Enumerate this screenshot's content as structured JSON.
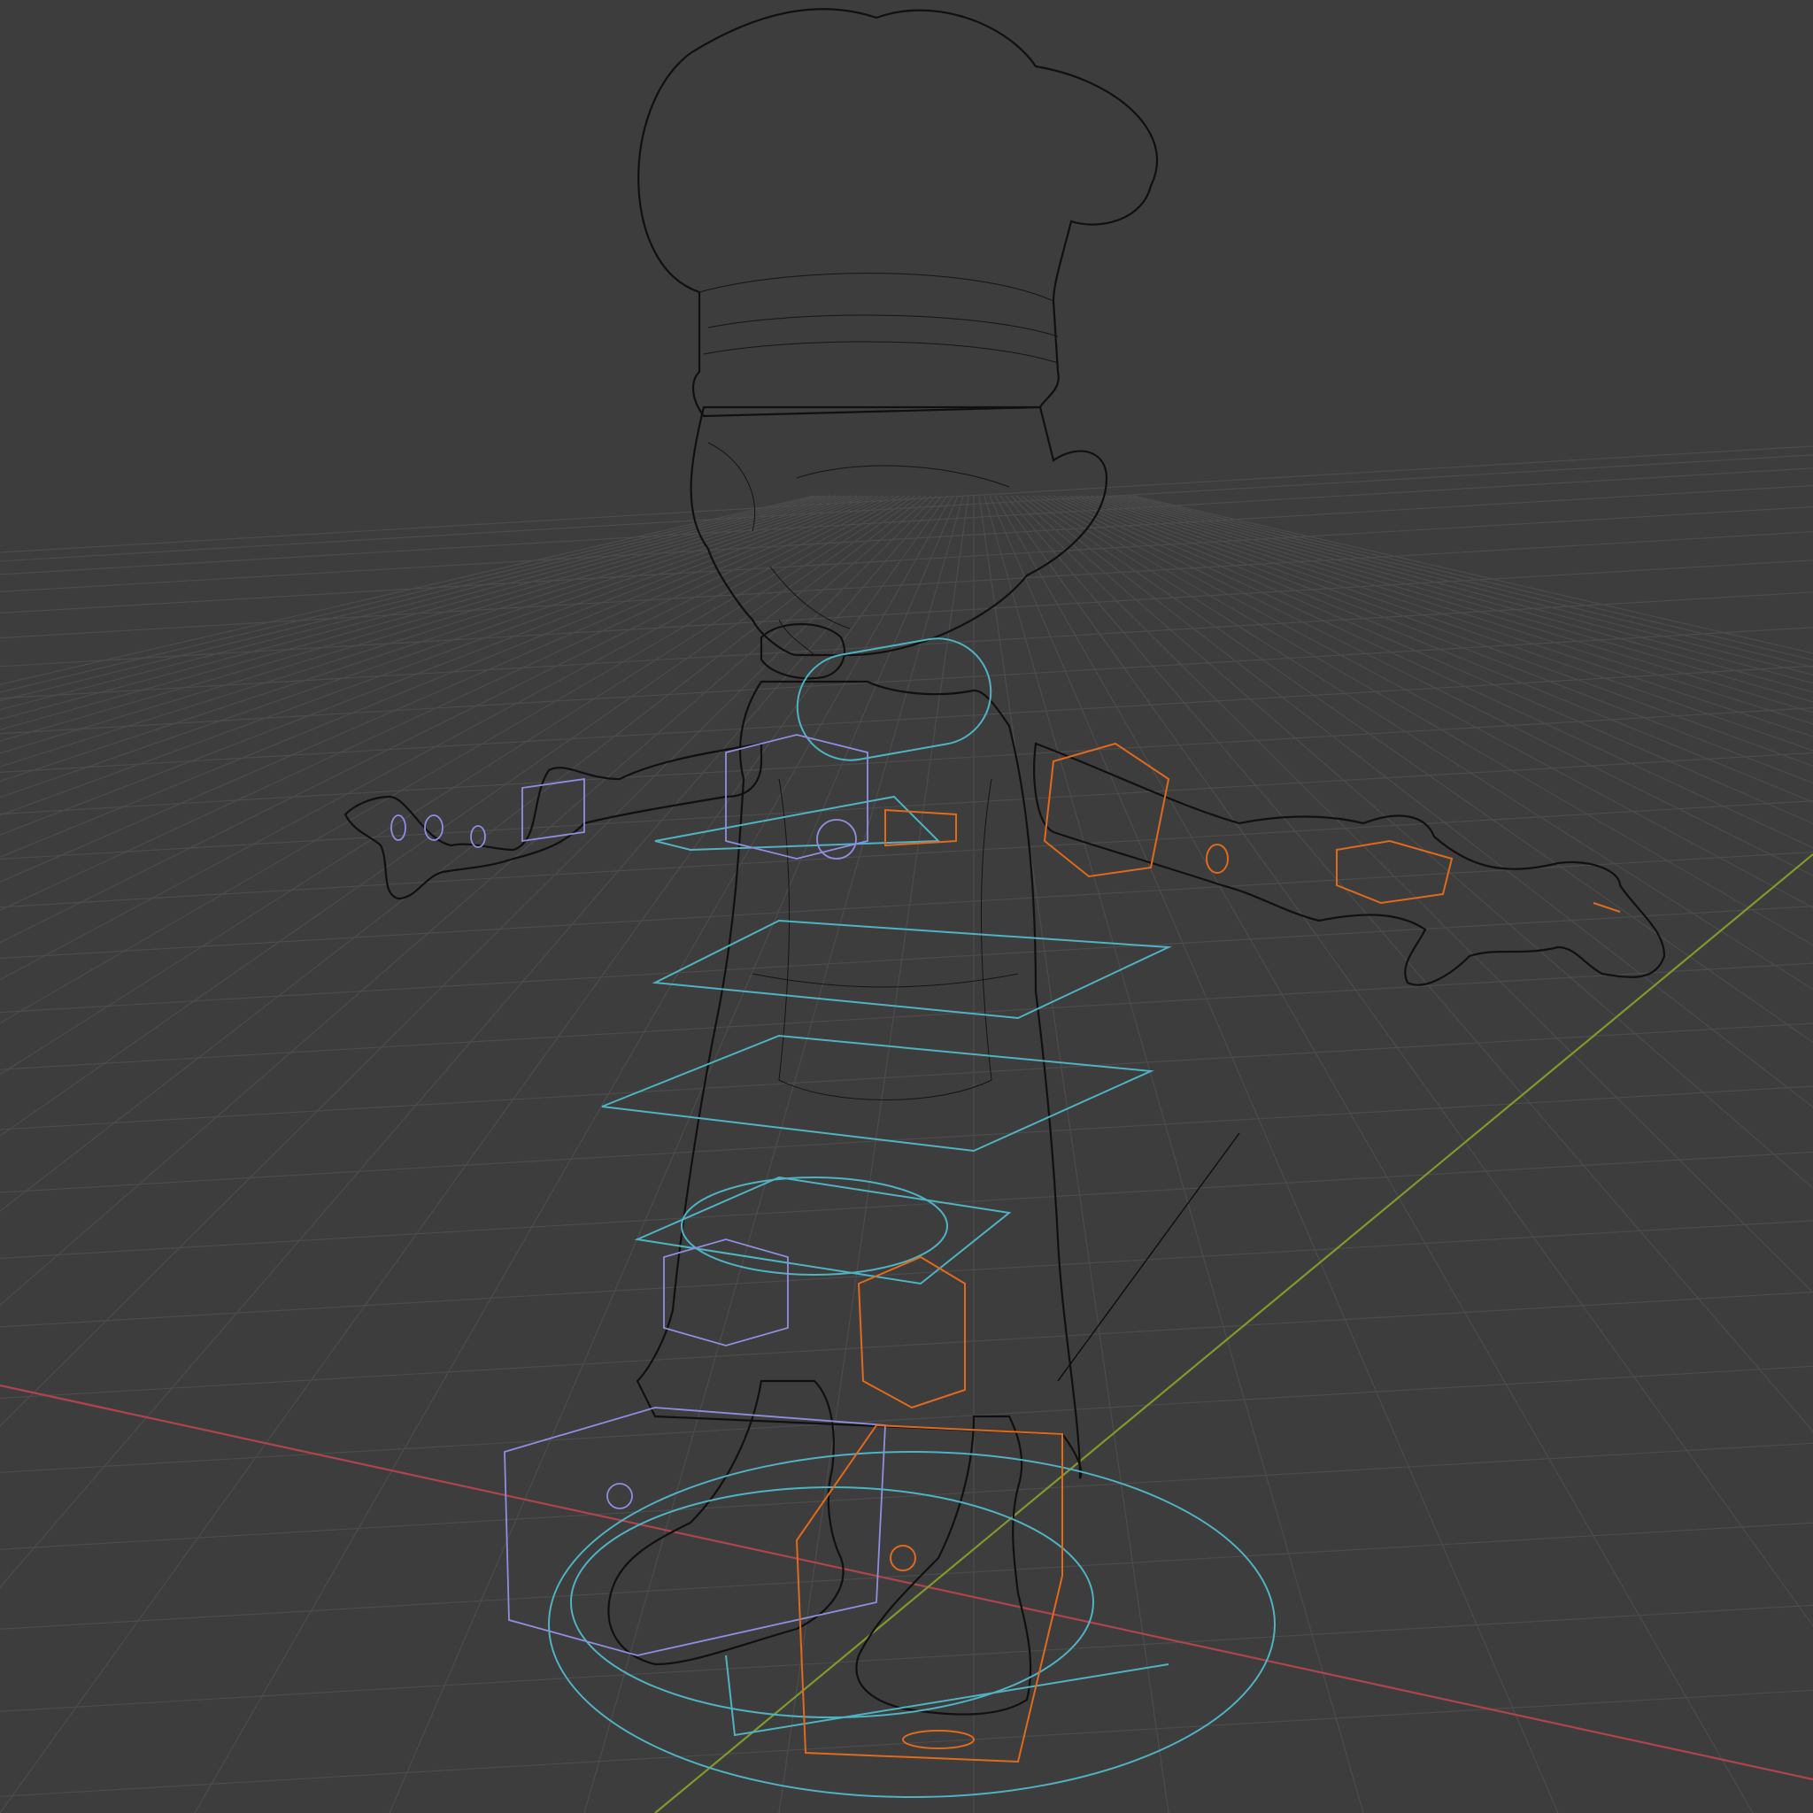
{
  "viewport": {
    "mode": "wireframe",
    "background_color": "#3d3d3d",
    "grid_color": "#4c4c4c",
    "mesh_wire_color": "#151515"
  },
  "axes": {
    "x_axis_color": "#b0444c",
    "y_axis_color": "#7f9a2c"
  },
  "character": {
    "type": "chef",
    "rig_colors": {
      "spine_and_root_controls": "#4fb3c4",
      "right_side_controls": "#8e8fe0",
      "left_side_controls": "#e06a1c"
    }
  }
}
